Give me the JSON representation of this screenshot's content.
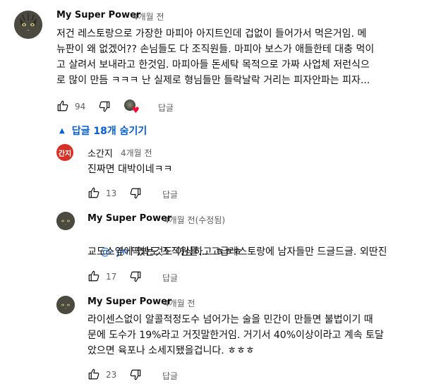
{
  "top_comment": {
    "author": "My Super Power",
    "time": "4개월 전",
    "lines": [
      "저건 레스토랑으로 가장한 마피아 아지트인데 겁없이 들어가서 먹은거임. 메",
      "뉴판이 왜 없겠어?? 손님들도 다 조직원들. 마피아 보스가 애들한테 대충 먹이",
      "고 살려서 보내라고 한것임. 마피아들 돈세탁 목적으로 가짜 사업체 저런식으",
      "로 많이 만듬 ㅋㅋㅋ 난 실제로 형님들만 들락날락 거리는 피자안파는 피자..."
    ],
    "likes": "94",
    "reply_label": "답글"
  },
  "replies_toggle": {
    "label": "답글 18개 숨기기",
    "icon": "caret-up-icon",
    "color": "#065fd4"
  },
  "replies": [
    {
      "avatar_text": "간지",
      "author": "소간지",
      "time": "4개월 전",
      "lines": [
        "진짜면 대박이네ㅋㅋ"
      ],
      "likes": "13",
      "reply_label": "답글"
    },
    {
      "author": "My Super Power",
      "time": "4개월 전(수정됨)",
      "mention": "@- jin",
      "lines": [
        "딱봐도 조직원들... 고급레스토랑에 남자들만 드글드글. 외딴진",
        "교도소옆에 있는것도 이상하고 ㅎㅎㅎ"
      ],
      "likes": "17",
      "reply_label": "답글"
    },
    {
      "author": "My Super Power",
      "time": "4개월 전",
      "lines": [
        "라이센스없이 알콜적정도수 넘어가는 술을 민간이 만들면 불법이기 때",
        "문에 도수가 19%라고 거짓말한거임. 거기서 40%이상이라고 계속 토달",
        "았으면 육포나 소세지됐을겁니다. ㅎㅎㅎ"
      ],
      "likes": "23",
      "reply_label": "답글"
    }
  ],
  "colors": {
    "link": "#065fd4",
    "secondary_text": "#606060",
    "heart": "#ff0033",
    "badge": "#d93025"
  }
}
